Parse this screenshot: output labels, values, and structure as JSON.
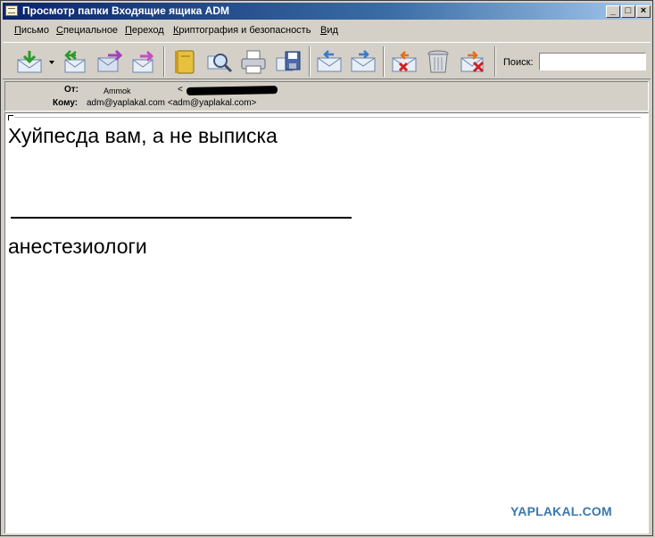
{
  "window": {
    "title": "Просмотр папки Входящие ящика ADM",
    "controls": {
      "minimize": "_",
      "maximize": "□",
      "close": "×"
    }
  },
  "menu": [
    {
      "first": "П",
      "rest": "исьмо"
    },
    {
      "first": "С",
      "rest": "пециальное"
    },
    {
      "first": "П",
      "rest": "ереход"
    },
    {
      "first": "К",
      "rest": "риптография и безопасность"
    },
    {
      "first": "В",
      "rest": "ид"
    }
  ],
  "toolbar": {
    "buttons": [
      "get-mail-icon",
      "reply-all-icon",
      "forward-icon",
      "redirect-icon",
      "address-book-icon",
      "search-mail-icon",
      "print-icon",
      "save-icon",
      "previous-icon",
      "next-icon",
      "delete-icon",
      "trash-icon",
      "junk-icon"
    ],
    "search_label": "Поиск:",
    "search_value": ""
  },
  "header": {
    "from_label": "От:",
    "from_name": "Ammok",
    "from_email_open": "<",
    "to_label": "Кому:",
    "to_value": "adm@yaplakal.com <adm@yaplakal.com>"
  },
  "message": {
    "line1": "Хуйпесда вам, а не выписка",
    "line2": "анестезиологи"
  },
  "watermark": "YAPLAKAL.COM",
  "colors": {
    "title_start": "#0a246a",
    "title_end": "#a6caf0",
    "chrome": "#d4d0c8",
    "watermark": "#3a78b0"
  }
}
